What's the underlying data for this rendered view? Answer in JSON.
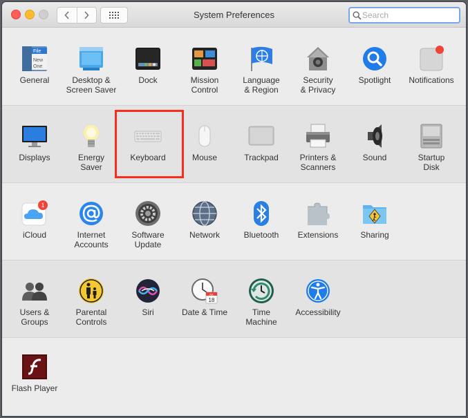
{
  "window": {
    "title": "System Preferences",
    "search_placeholder": "Search"
  },
  "rows": [
    [
      {
        "label": "General",
        "icon": "general-icon"
      },
      {
        "label": "Desktop &\nScreen Saver",
        "icon": "desktop-screensaver-icon"
      },
      {
        "label": "Dock",
        "icon": "dock-icon"
      },
      {
        "label": "Mission\nControl",
        "icon": "mission-control-icon"
      },
      {
        "label": "Language\n& Region",
        "icon": "language-region-icon"
      },
      {
        "label": "Security\n& Privacy",
        "icon": "security-privacy-icon"
      },
      {
        "label": "Spotlight",
        "icon": "spotlight-icon"
      },
      {
        "label": "Notifications",
        "icon": "notifications-icon"
      }
    ],
    [
      {
        "label": "Displays",
        "icon": "displays-icon"
      },
      {
        "label": "Energy\nSaver",
        "icon": "energy-saver-icon"
      },
      {
        "label": "Keyboard",
        "icon": "keyboard-icon"
      },
      {
        "label": "Mouse",
        "icon": "mouse-icon"
      },
      {
        "label": "Trackpad",
        "icon": "trackpad-icon"
      },
      {
        "label": "Printers &\nScanners",
        "icon": "printers-scanners-icon"
      },
      {
        "label": "Sound",
        "icon": "sound-icon"
      },
      {
        "label": "Startup\nDisk",
        "icon": "startup-disk-icon"
      }
    ],
    [
      {
        "label": "iCloud",
        "icon": "icloud-icon",
        "badge": "1"
      },
      {
        "label": "Internet\nAccounts",
        "icon": "internet-accounts-icon"
      },
      {
        "label": "Software\nUpdate",
        "icon": "software-update-icon"
      },
      {
        "label": "Network",
        "icon": "network-icon"
      },
      {
        "label": "Bluetooth",
        "icon": "bluetooth-icon"
      },
      {
        "label": "Extensions",
        "icon": "extensions-icon"
      },
      {
        "label": "Sharing",
        "icon": "sharing-icon"
      }
    ],
    [
      {
        "label": "Users &\nGroups",
        "icon": "users-groups-icon"
      },
      {
        "label": "Parental\nControls",
        "icon": "parental-controls-icon"
      },
      {
        "label": "Siri",
        "icon": "siri-icon"
      },
      {
        "label": "Date & Time",
        "icon": "date-time-icon",
        "calendar_month": "JUL",
        "calendar_day": "18"
      },
      {
        "label": "Time\nMachine",
        "icon": "time-machine-icon"
      },
      {
        "label": "Accessibility",
        "icon": "accessibility-icon"
      }
    ],
    [
      {
        "label": "Flash Player",
        "icon": "flash-player-icon"
      }
    ]
  ],
  "general_icon_text": [
    "File",
    "New",
    "One"
  ],
  "colors": {
    "highlight": "#fa2c1c",
    "accent_blue": "#1f7ce8"
  }
}
